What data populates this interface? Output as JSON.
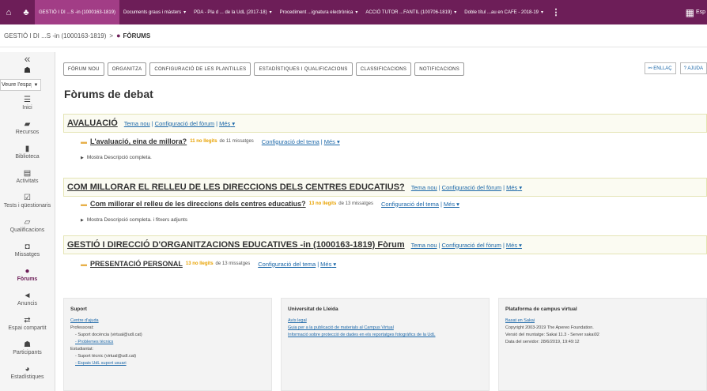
{
  "topbar": {
    "sites": [
      {
        "label": "GESTIÓ I DI ...S -in (1000163-1819)",
        "chevron": false,
        "active": true
      },
      {
        "label": "Documents graus i màsters",
        "chevron": true
      },
      {
        "label": "PDA - Pla d ... de la UdL (2017-18)",
        "chevron": true
      },
      {
        "label": "Procediment ...ignatura electrònica",
        "chevron": true
      },
      {
        "label": "ACCIÓ TUTOR ...FANTIL (100706-1819)",
        "chevron": true
      },
      {
        "label": "Doble títul ...au en CAFE - 2018-19",
        "chevron": true
      }
    ],
    "right_label": "Esp"
  },
  "breadcrumb": {
    "site": "GESTIÓ I DI ...S -in (1000163-1819)",
    "separator": ">",
    "current": "FÒRUMS"
  },
  "toolmenu": {
    "view_as": "Veure l'espai",
    "tools": [
      {
        "label": "Inici",
        "icon": "list-icon",
        "glyph": "☰"
      },
      {
        "label": "Recursos",
        "icon": "folder-icon",
        "glyph": "▰"
      },
      {
        "label": "Biblioteca",
        "icon": "bookmark-icon",
        "glyph": "▮"
      },
      {
        "label": "Activitats",
        "icon": "file-icon",
        "glyph": "▤"
      },
      {
        "label": "Tests i qüestionaris",
        "icon": "check-icon",
        "glyph": "☑"
      },
      {
        "label": "Qualificacions",
        "icon": "book-icon",
        "glyph": "▱"
      },
      {
        "label": "Missatges",
        "icon": "inbox-icon",
        "glyph": "◘"
      },
      {
        "label": "Fòrums",
        "icon": "chat-icon",
        "glyph": "●",
        "active": true
      },
      {
        "label": "Anuncis",
        "icon": "bullhorn-icon",
        "glyph": "◄"
      },
      {
        "label": "Espai compartit",
        "icon": "exchange-icon",
        "glyph": "⇄"
      },
      {
        "label": "Participants",
        "icon": "users-icon",
        "glyph": "☗"
      },
      {
        "label": "Estadístiques",
        "icon": "chart-icon",
        "glyph": "◕"
      }
    ]
  },
  "nav_buttons": [
    "FÒRUM NOU",
    "ORGANITZA",
    "CONFIGURACIÓ DE LES PLANTILLES",
    "ESTADÍSTIQUES I QUALIFICACIONS",
    "CLASSIFICACIONS",
    "NOTIFICACIONS"
  ],
  "link_button": "ENLLAÇ",
  "help_button": "AJUDA",
  "page_title": "Fòrums de debat",
  "links": {
    "new_topic": "Tema nou",
    "forum_settings": "Configuració del fòrum",
    "topic_settings": "Configuració del tema",
    "more": "Més"
  },
  "forums": [
    {
      "title": "AVALUACIÓ",
      "topics": [
        {
          "title": "L'avaluació, eina de millora?",
          "unread": "11 no llegits",
          "messages": "de 11 missatges"
        }
      ],
      "description": "Mostra Descripció completa."
    },
    {
      "title": "COM MILLORAR EL RELLEU DE LES DIRECCIONS DELS CENTRES EDUCATIUS?",
      "topics": [
        {
          "title": "Com millorar el relleu de les direccions dels centres educatius?",
          "unread": "13 no llegits",
          "messages": "de 13 missatges"
        }
      ],
      "description": "Mostra Descripció completa. i fitxers adjunts"
    },
    {
      "title": "GESTIÓ I DIRECCIÓ D'ORGANITZACIONS EDUCATIVES -in (1000163-1819) Fòrum",
      "topics": [
        {
          "title": "PRESENTACIÓ PERSONAL",
          "unread": "13 no llegits",
          "messages": "de 13 missatges"
        }
      ]
    }
  ],
  "footer": {
    "support": {
      "heading": "Suport",
      "rows": [
        {
          "text": "Centre d'ajuda",
          "link": true
        },
        {
          "text": "Professorat:"
        },
        {
          "text": "- Suport docència (virtual@udl.cat)",
          "indent": true
        },
        {
          "text": "- Problemes tècnics",
          "link": true,
          "indent": true
        },
        {
          "text": "Estudiantat:"
        },
        {
          "text": "- Suport tècnic (virtual@udl.cat)",
          "indent": true
        },
        {
          "text": "- Espais UdL suport usuari",
          "link": true,
          "indent": true
        }
      ]
    },
    "university": {
      "heading": "Universitat de Lleida",
      "rows": [
        {
          "text": "Avís legal",
          "link": true
        },
        {
          "text": "Guia per a la publicació de materials al Campus Virtual",
          "link": true
        },
        {
          "text": "Informació sobre protecció de dades en els reportatges fotogràfics de la UdL",
          "link": true
        }
      ]
    },
    "platform": {
      "heading": "Plataforma de campus virtual",
      "rows": [
        {
          "text": "Basat en Sakai",
          "link": true
        },
        {
          "text": "Copyright 2003-2019 The Apereo Foundation."
        },
        {
          "text": "Versió del muntatge: Sakai 11.3 - Server sakai02"
        },
        {
          "text": "Data del servidor: 28/6/2019, 19:49:12"
        }
      ]
    }
  },
  "colors": {
    "topbar": "#6d1e58",
    "active_site": "#a23d86",
    "link": "#1b67a8",
    "unread": "#e8a200"
  }
}
